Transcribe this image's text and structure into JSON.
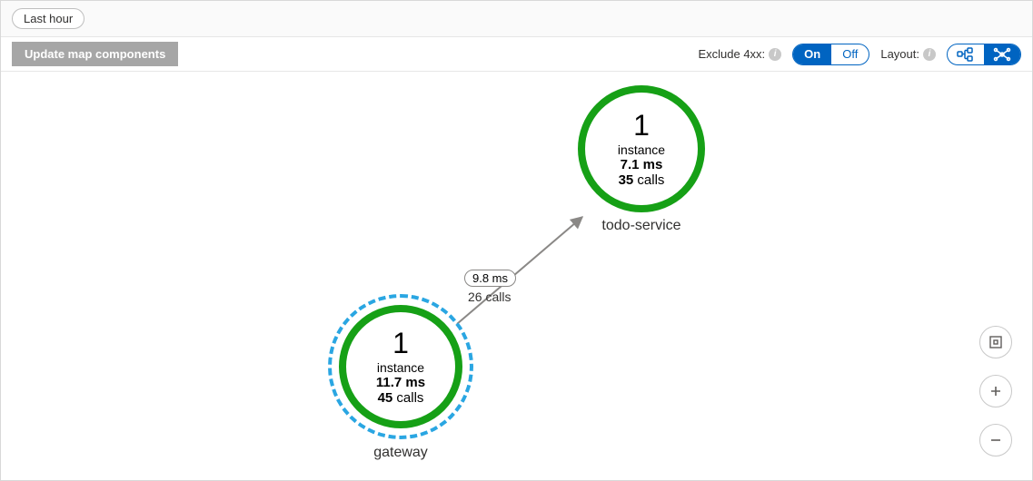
{
  "timeRange": {
    "label": "Last hour"
  },
  "toolbar": {
    "updateLabel": "Update map components",
    "excludeLabel": "Exclude 4xx:",
    "excludeOn": "On",
    "excludeOff": "Off",
    "layoutLabel": "Layout:"
  },
  "edge": {
    "latency": "9.8 ms",
    "callsText": "26 calls"
  },
  "nodes": {
    "gateway": {
      "name": "gateway",
      "instanceCount": "1",
      "instanceWord": "instance",
      "latency": "11.7 ms",
      "callsNum": "45",
      "callsWord": "calls",
      "selected": true
    },
    "todoService": {
      "name": "todo-service",
      "instanceCount": "1",
      "instanceWord": "instance",
      "latency": "7.1 ms",
      "callsNum": "35",
      "callsWord": "calls",
      "selected": false
    }
  },
  "colors": {
    "ringGreen": "#16a016",
    "selectBlue": "#2aa6e2",
    "accent": "#0064c1"
  }
}
